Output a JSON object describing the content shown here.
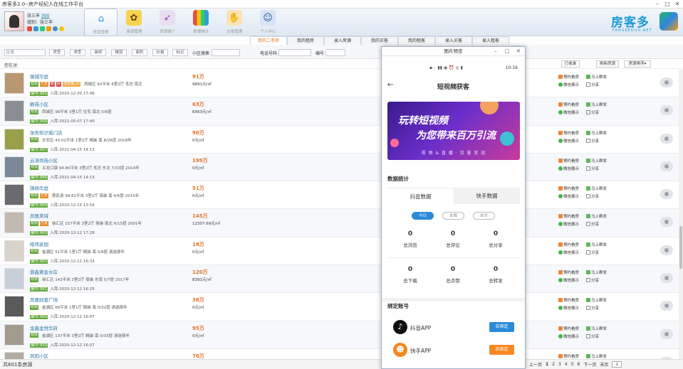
{
  "app": {
    "title": "房客多2.0--房产经纪人在线工作平台"
  },
  "user": {
    "name": "张三丰",
    "score": "300",
    "role_label": "组别：",
    "role": "张三丰"
  },
  "topnav": [
    {
      "label": "房源管理",
      "icon": "home-icon",
      "color": "#3b8fd6"
    },
    {
      "label": "客源管理",
      "icon": "bee-icon",
      "color": "#f2b632"
    },
    {
      "label": "房源推广",
      "icon": "rocket-icon",
      "color": "#9b59b6"
    },
    {
      "label": "数据统计",
      "icon": "bar-chart-icon",
      "color": "#e67e22"
    },
    {
      "label": "交易管理",
      "icon": "handshake-icon",
      "color": "#f5b041"
    },
    {
      "label": "个人中心",
      "icon": "person-icon",
      "color": "#4a7bbd"
    }
  ],
  "logo": {
    "text": "房客多",
    "sub": "FANGKEDUO.NET"
  },
  "tabs": [
    "我的二手房",
    "我的租房",
    "录入房源",
    "我的买客",
    "我的租客",
    "录入买客",
    "录入租客"
  ],
  "filters": {
    "district": "区县",
    "type": "房型",
    "kind": "类型",
    "deco": "装修",
    "floor": "楼层",
    "area": "面积",
    "price": "价格",
    "tag": "标记",
    "xiaoqu_label": "小区搜索",
    "phone_label": "电话号码",
    "code_label": "编号"
  },
  "sort": {
    "location_label": "您在对:",
    "fav": "已收录",
    "refresh": "刷新房源",
    "order": "房源排序▾"
  },
  "listings": [
    {
      "name": "御城华庭",
      "tags": [
        "有效",
        "已发",
        "新",
        "抖",
        "浏览量:37"
      ],
      "detail": "西城区  92平米  4室2厅  毛坯  南北",
      "id": "编号:965",
      "date": "入库:2020-12-30 17:46",
      "price": "91万",
      "unit": "9891元/㎡",
      "thumb": "#b99770"
    },
    {
      "name": "静苑小区",
      "tags": [
        "有效"
      ],
      "detail": "西城区  96平米  3室1厅  住宅  南北  0/6层",
      "id": "编号:968",
      "date": "入库:2021-05-07 17:40",
      "price": "63万",
      "unit": "6563元/㎡",
      "thumb": "#8a8d93"
    },
    {
      "name": "张秀知识城门店",
      "tags": [
        "有效"
      ],
      "detail": "长安区  43.02平米  1室1厅  精装  南  8/26层  2018年",
      "id": "编号:967",
      "date": "入库:2021-04-15 14:13",
      "price": "90万",
      "unit": "0元/㎡",
      "thumb": "#9aa04a"
    },
    {
      "name": "云涛尚苑小区",
      "tags": [
        "有效"
      ],
      "detail": "五龙口镇  94.80平米  3室2厅  毛坯  东北  7/33层  2014年",
      "id": "编号:966",
      "date": "入库:2021-04-15 14:13",
      "price": "199万",
      "unit": "0元/㎡",
      "thumb": "#7a8797"
    },
    {
      "name": "锦扬华庭",
      "tags": [
        "有效",
        "已发"
      ],
      "detail": "惠民县  99.81平米  3室2厅  简装  南  4/6层  2015年",
      "id": "编号:964",
      "date": "入库:2020-12-15 13:54",
      "price": "51万",
      "unit": "0元/㎡",
      "thumb": "#6b6a70"
    },
    {
      "name": "凤凰美域",
      "tags": [
        "有效",
        "已发"
      ],
      "detail": "徐汇区  157平米  3室2厅  简装  南北  6/15层  2001年",
      "id": "编号:963",
      "date": "入库:2020-12-12 17:28",
      "price": "145万",
      "unit": "12307.69元/㎡",
      "thumb": "#c2b9b0"
    },
    {
      "name": "皓伟家园",
      "tags": [
        "有效"
      ],
      "detail": "盐湖区  51平米  1室1厅  精装  南  5/6层  请选择年",
      "id": "编号:962",
      "date": "入库:2020-12-12 16:33",
      "price": "18万",
      "unit": "0元/㎡",
      "thumb": "#d8d4cc"
    },
    {
      "name": "鼎鑫黄金水岸",
      "tags": [
        "有效"
      ],
      "detail": "徐汇区  143平米  3室2厅  豪装  东南  5/7层  2017年",
      "id": "编号:961",
      "date": "入库:2020-12-12 16:25",
      "price": "120万",
      "unit": "8391元/㎡",
      "thumb": "#c8cfd8"
    },
    {
      "name": "凤凰财富广场",
      "tags": [
        "有效"
      ],
      "detail": "盐湖区  66平米  1室1厅  精装  南  0/32层  请选择年",
      "id": "编号:960",
      "date": "入库:2020-12-12 16:07",
      "price": "38万",
      "unit": "0元/㎡",
      "thumb": "#5a5a5a"
    },
    {
      "name": "金鑫金悦华府",
      "tags": [
        "有效"
      ],
      "detail": "盐湖区  137平米  3室2厅  精装  南  0/33层  请选择年",
      "id": "编号:959",
      "date": "入库:2020-12-12 16:07",
      "price": "95万",
      "unit": "0元/㎡",
      "thumb": "#a39b8f"
    },
    {
      "name": "凤阳小区",
      "tags": [
        "有效"
      ],
      "detail": "",
      "id": "",
      "date": "",
      "price": "76万",
      "unit": "0元/㎡",
      "thumb": "#b3aca2"
    }
  ],
  "row_actions": {
    "appoint": "预约看房",
    "publish": "马上群发",
    "wechat": "微信展示",
    "share": "分享"
  },
  "status": {
    "count": "共601条房源",
    "prev": "上一页",
    "next": "下一页",
    "last": "末页",
    "pages": [
      "1",
      "2",
      "3",
      "4",
      "5",
      "6"
    ],
    "current": "1"
  },
  "preview": {
    "window_title": "图片预览",
    "time": "10:16",
    "page_title": "短视频获客",
    "banner_line1": "玩转短视频",
    "banner_line2": "为您带来百万引流",
    "banner_line3": "视 频 & 直 播 · 流 量 变 现",
    "stats_title": "数据统计",
    "tab_douyin": "抖音数据",
    "tab_kuaishou": "快手数据",
    "pill_today": "今日",
    "pill_week": "本周",
    "pill_month": "本月",
    "stats": [
      {
        "value": "0",
        "label": "总浏览"
      },
      {
        "value": "0",
        "label": "总评论"
      },
      {
        "value": "0",
        "label": "总分享"
      },
      {
        "value": "0",
        "label": "总下载"
      },
      {
        "value": "0",
        "label": "总点赞"
      },
      {
        "value": "0",
        "label": "总转发"
      }
    ],
    "bind_title": "绑定账号",
    "acct_douyin": "抖音APP",
    "acct_kuaishou": "快手APP",
    "bind_btn": "去绑定"
  }
}
